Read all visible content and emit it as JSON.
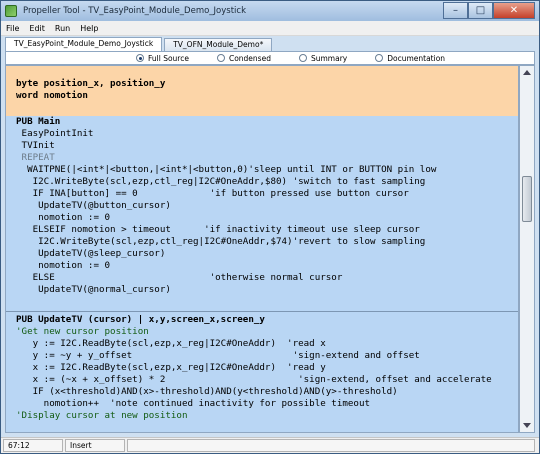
{
  "window": {
    "title": "Propeller Tool - TV_EasyPoint_Module_Demo_Joystick"
  },
  "menu": {
    "items": [
      "File",
      "Edit",
      "Run",
      "Help"
    ]
  },
  "tabs": [
    {
      "label": "TV_EasyPoint_Module_Demo_Joystick",
      "active": true
    },
    {
      "label": "TV_OFN_Module_Demo*",
      "active": false
    }
  ],
  "view_modes": {
    "options": [
      "Full Source",
      "Condensed",
      "Summary",
      "Documentation"
    ],
    "selected": "Full Source"
  },
  "code": {
    "var_block": [
      "byte position_x, position_y",
      "word nomotion"
    ],
    "main_block": [
      "PUB Main",
      " EasyPointInit",
      " TVInit",
      " REPEAT",
      "  WAITPNE(|<int*|<button,|<int*|<button,0)'sleep until INT or BUTTON pin low",
      "   I2C.WriteByte(scl,ezp,ctl_reg|I2C#OneAddr,$80) 'switch to fast sampling",
      "   IF INA[button] == 0             'if button pressed use button cursor",
      "    UpdateTV(@button_cursor)",
      "    nomotion := 0",
      "   ELSEIF nomotion > timeout      'if inactivity timeout use sleep cursor",
      "    I2C.WriteByte(scl,ezp,ctl_reg|I2C#OneAddr,$74)'revert to slow sampling",
      "    UpdateTV(@sleep_cursor)",
      "    nomotion := 0",
      "   ELSE                            'otherwise normal cursor",
      "    UpdateTV(@normal_cursor)"
    ],
    "update_block": [
      "PUB UpdateTV (cursor) | x,y,screen_x,screen_y",
      "'Get new cursor position",
      "   y := I2C.ReadByte(scl,ezp,x_reg|I2C#OneAddr)  'read x",
      "   y := ~y + y_offset                             'sign-extend and offset",
      "   x := I2C.ReadByte(scl,ezp,x_reg|I2C#OneAddr)  'read y",
      "   x := (~x + x_offset) * 2                        'sign-extend, offset and accelerate",
      "   IF (x<threshold)AND(x>-threshold)AND(y<threshold)AND(y>-threshold)",
      "     nomotion++  'note continued inactivity for possible timeout",
      "'Display cursor at new position"
    ]
  },
  "status": {
    "position": "67:12",
    "mode": "Insert"
  },
  "colors": {
    "var_block_bg": "#fcd5a8",
    "pub_block_bg": "#b9d6f4",
    "comment": "#135c13"
  }
}
